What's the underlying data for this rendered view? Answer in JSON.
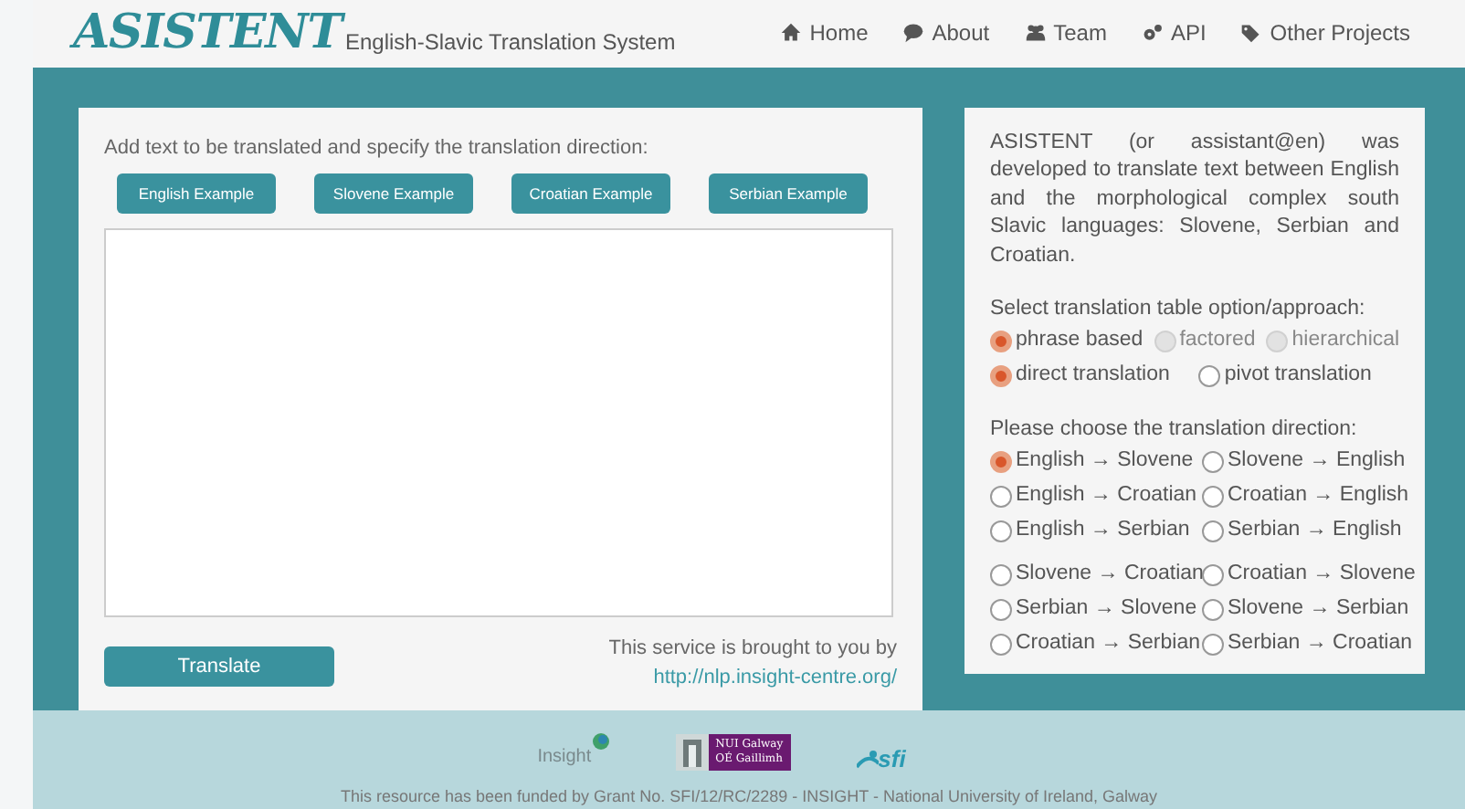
{
  "header": {
    "logo": "ASISTENT",
    "subtitle": "English-Slavic Translation System",
    "nav": [
      {
        "label": "Home"
      },
      {
        "label": "About"
      },
      {
        "label": "Team"
      },
      {
        "label": "API"
      },
      {
        "label": "Other Projects"
      }
    ]
  },
  "input_panel": {
    "instruction": "Add text to be translated and specify the translation direction:",
    "example_buttons": [
      "English Example",
      "Slovene Example",
      "Croatian Example",
      "Serbian Example"
    ],
    "translate_button": "Translate",
    "credit": "This service is brought to you by",
    "credit_link": "http://nlp.insight-centre.org/"
  },
  "info_panel": {
    "description": "ASISTENT (or assistant@en) was developed to translate text between English and the morphological complex south Slavic languages: Slovene, Serbian and Croatian.",
    "approach_label": "Select translation table option/approach:",
    "approach_rows": [
      [
        {
          "label": "phrase based",
          "selected": true,
          "disabled": false
        },
        {
          "label": "factored",
          "selected": false,
          "disabled": true
        },
        {
          "label": "hierarchical",
          "selected": false,
          "disabled": true
        }
      ],
      [
        {
          "label": "direct translation",
          "selected": true,
          "disabled": false
        },
        {
          "label": "pivot translation",
          "selected": false,
          "disabled": false
        }
      ]
    ],
    "direction_label": "Please choose the translation direction:",
    "direction_groups": [
      [
        {
          "label": "English → Slovene",
          "selected": true
        },
        {
          "label": "Slovene → English",
          "selected": false
        },
        {
          "label": "English → Croatian",
          "selected": false
        },
        {
          "label": "Croatian → English",
          "selected": false
        },
        {
          "label": "English → Serbian",
          "selected": false
        },
        {
          "label": "Serbian → English",
          "selected": false
        }
      ],
      [
        {
          "label": "Slovene → Croatian",
          "selected": false
        },
        {
          "label": "Croatian → Slovene",
          "selected": false
        },
        {
          "label": "Serbian → Slovene",
          "selected": false
        },
        {
          "label": "Slovene → Serbian",
          "selected": false
        },
        {
          "label": "Croatian → Serbian",
          "selected": false
        },
        {
          "label": "Serbian → Croatian",
          "selected": false
        }
      ]
    ]
  },
  "footer": {
    "logos": [
      {
        "kind": "insight",
        "text": "Insight"
      },
      {
        "kind": "nui",
        "text": "NUI Galway",
        "subtext": "OÉ Gaillimh"
      },
      {
        "kind": "sfi",
        "text": "sfi"
      }
    ],
    "funding": "This resource has been funded by Grant No. SFI/12/RC/2289 - INSIGHT - National University of Ireland, Galway"
  }
}
